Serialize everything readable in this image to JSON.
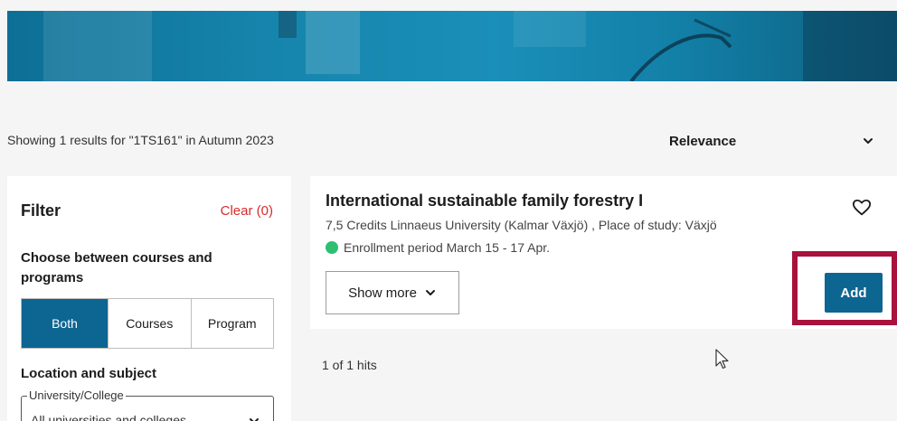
{
  "results": {
    "summary": "Showing 1 results for \"1TS161\" in Autumn 2023",
    "sort_label": "Relevance",
    "hits": "1 of 1 hits"
  },
  "filter": {
    "title": "Filter",
    "clear_label": "Clear (0)",
    "choose_heading": "Choose between courses and programs",
    "segments": [
      "Both",
      "Courses",
      "Program"
    ],
    "selected_segment": "Both",
    "location_heading": "Location and subject",
    "university_legend": "University/College",
    "university_value": "All universities and colleges"
  },
  "course": {
    "title": "International sustainable family forestry I",
    "meta": "7,5 Credits Linnaeus University (Kalmar Växjö) , Place of study: Växjö",
    "enrollment": "Enrollment period March 15 - 17 Apr.",
    "show_more_label": "Show more",
    "add_label": "Add"
  },
  "colors": {
    "accent": "#0d6591",
    "clear_red": "#d92b2b",
    "highlight": "#a8123d",
    "status_green": "#2fbf71"
  },
  "icons": {
    "sort": "chevron-down-icon",
    "favorite": "heart-icon",
    "status": "status-dot-icon",
    "cursor": "mouse-cursor-icon"
  }
}
